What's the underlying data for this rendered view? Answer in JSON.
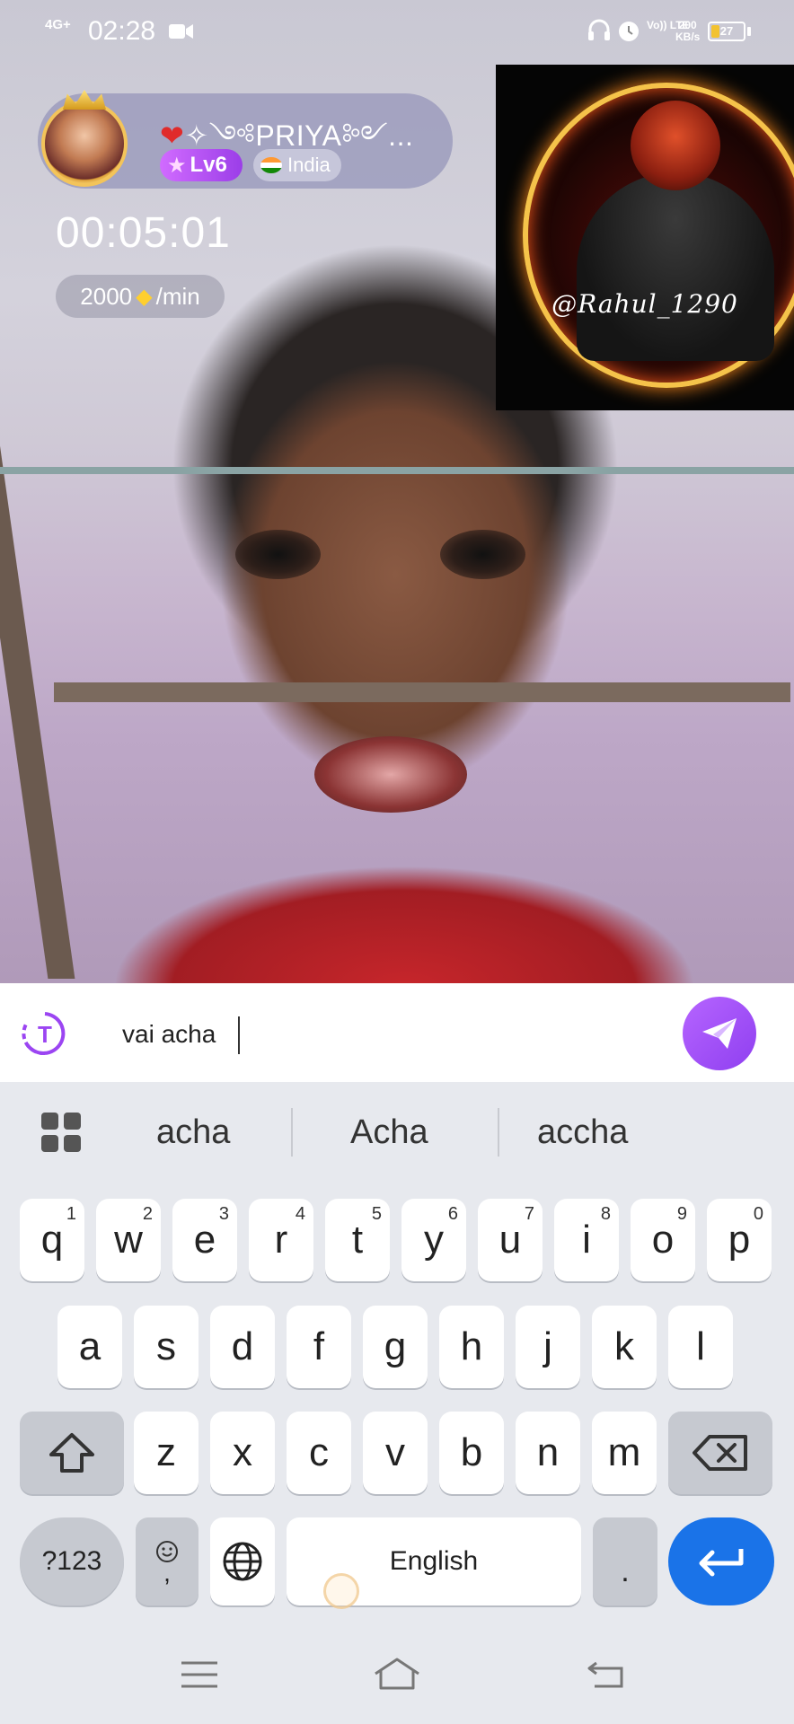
{
  "status_bar": {
    "network": "4G+",
    "time": "02:28",
    "volte": "Vo)) LTE",
    "speed_value": "200",
    "speed_unit": "KB/s",
    "battery_percent": 27,
    "battery_label": "27"
  },
  "caller": {
    "name": "✧༺PRIYA༻...",
    "level": "Lv6",
    "country": "India",
    "call_timer": "00:05:01",
    "rate_amount": "2000",
    "rate_unit": "/min"
  },
  "self_preview": {
    "label": "@Rahul_1290"
  },
  "input_bar": {
    "message_value": "vai acha",
    "send_icon": "send-icon",
    "translate_icon": "translate-icon"
  },
  "keyboard": {
    "suggestions": [
      "acha",
      "Acha",
      "accha"
    ],
    "row1": [
      {
        "key": "q",
        "num": "1"
      },
      {
        "key": "w",
        "num": "2"
      },
      {
        "key": "e",
        "num": "3"
      },
      {
        "key": "r",
        "num": "4"
      },
      {
        "key": "t",
        "num": "5"
      },
      {
        "key": "y",
        "num": "6"
      },
      {
        "key": "u",
        "num": "7"
      },
      {
        "key": "i",
        "num": "8"
      },
      {
        "key": "o",
        "num": "9"
      },
      {
        "key": "p",
        "num": "0"
      }
    ],
    "row2": [
      "a",
      "s",
      "d",
      "f",
      "g",
      "h",
      "j",
      "k",
      "l"
    ],
    "row3": [
      "z",
      "x",
      "c",
      "v",
      "b",
      "n",
      "m"
    ],
    "symbols_label": "?123",
    "emoji_comma": ",",
    "space_label": "English",
    "period_label": "."
  },
  "colors": {
    "accent_purple": "#9b45f2",
    "enter_blue": "#1a73e8"
  }
}
